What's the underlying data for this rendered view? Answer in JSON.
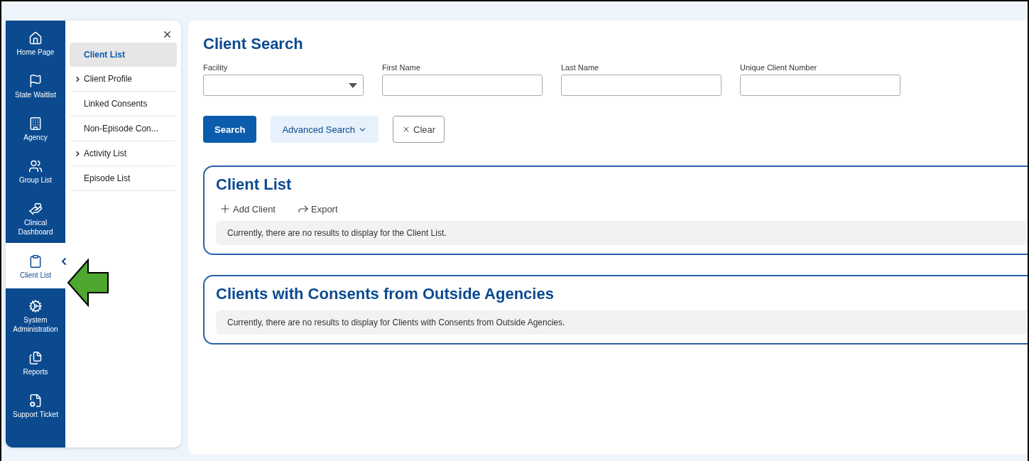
{
  "nav_rail": {
    "items": [
      {
        "label": "Home Page",
        "selected": false
      },
      {
        "label": "State Waitlist",
        "selected": false
      },
      {
        "label": "Agency",
        "selected": false
      },
      {
        "label": "Group List",
        "selected": false
      },
      {
        "label": "Clinical Dashboard",
        "selected": false
      },
      {
        "label": "Client List",
        "selected": true
      },
      {
        "label": "System Administration",
        "selected": false
      },
      {
        "label": "Reports",
        "selected": false
      },
      {
        "label": "Support Ticket",
        "selected": false
      }
    ]
  },
  "submenu": {
    "items": [
      {
        "label": "Client List",
        "selected": true,
        "has_children": false
      },
      {
        "label": "Client Profile",
        "selected": false,
        "has_children": true
      },
      {
        "label": "Linked Consents",
        "selected": false,
        "has_children": false
      },
      {
        "label": "Non-Episode Con...",
        "selected": false,
        "has_children": false
      },
      {
        "label": "Activity List",
        "selected": false,
        "has_children": true
      },
      {
        "label": "Episode List",
        "selected": false,
        "has_children": false
      }
    ]
  },
  "client_search": {
    "title": "Client Search",
    "fields": [
      {
        "label": "Facility",
        "kind": "select"
      },
      {
        "label": "First Name",
        "kind": "text"
      },
      {
        "label": "Last Name",
        "kind": "text"
      },
      {
        "label": "Unique Client Number",
        "kind": "text"
      }
    ],
    "buttons": [
      {
        "label": "Search",
        "kind": "primary"
      },
      {
        "label": "Advanced Search",
        "kind": "dropdown"
      },
      {
        "label": "Clear",
        "kind": "clear"
      }
    ]
  },
  "sections": [
    {
      "title": "Client List",
      "actions": [
        {
          "label": "Add Client",
          "kind": "add"
        },
        {
          "label": "Export",
          "kind": "export"
        }
      ],
      "message": "Currently, there are no results to display for the Client List."
    },
    {
      "title": "Clients with Consents from Outside Agencies",
      "message": "Currently, there are no results to display for Clients with Consents from Outside Agencies."
    }
  ]
}
